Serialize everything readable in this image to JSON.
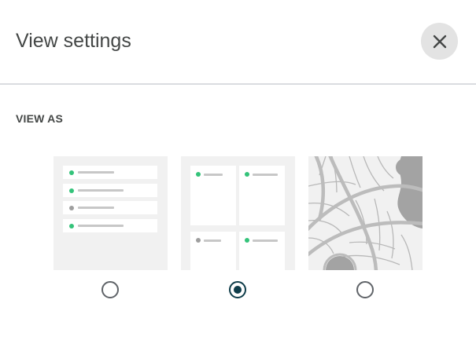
{
  "dialog": {
    "title": "View settings",
    "close_icon": "close-icon"
  },
  "view_as": {
    "label": "VIEW AS",
    "options": [
      {
        "id": "list",
        "icon": "list-view-thumbnail",
        "selected": false
      },
      {
        "id": "grid",
        "icon": "grid-view-thumbnail",
        "selected": true
      },
      {
        "id": "map",
        "icon": "map-view-thumbnail",
        "selected": false
      }
    ]
  },
  "colors": {
    "accent": "#0f3d4a",
    "status_green": "#34c37a",
    "status_gray": "#9e9e9e",
    "thumbnail_bg": "#f1f1f1",
    "close_button_bg": "#e3e3e3"
  }
}
